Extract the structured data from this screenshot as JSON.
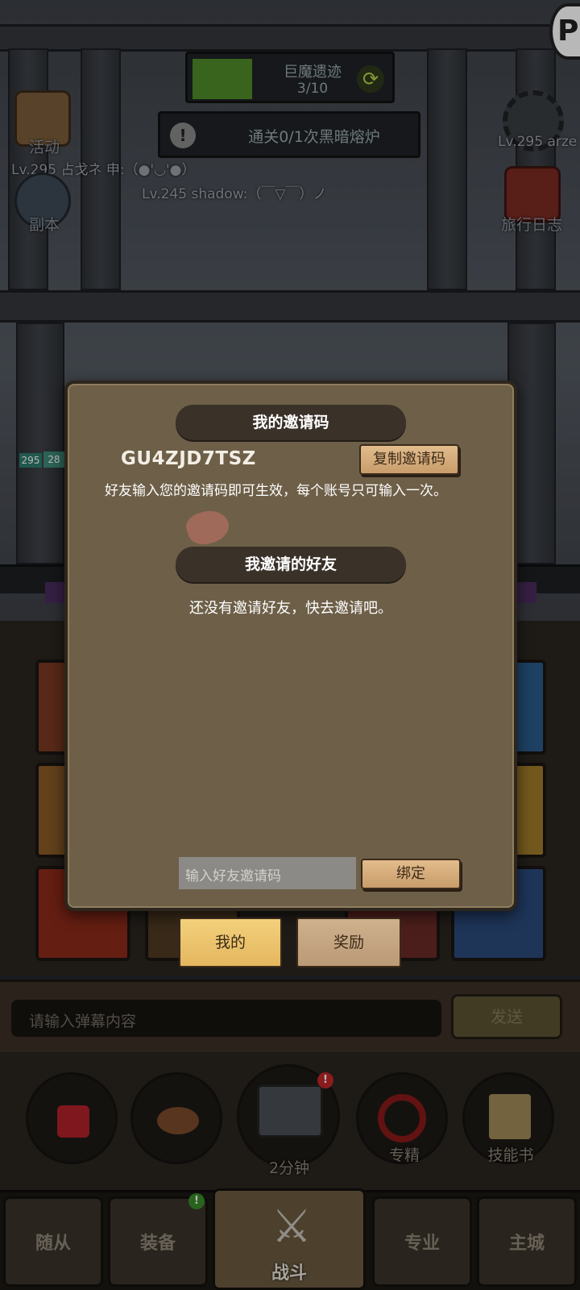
{
  "hud": {
    "dungeon_name": "巨魔遗迹",
    "dungeon_progress": "3/10",
    "quest_text": "通关0/1次黑暗熔炉",
    "activity_label": "活动",
    "dungeon_label": "副本",
    "travel_log_label": "旅行日志",
    "player1": "Lv.295 占戈ネ 申:（●'◡'●）",
    "player2": "Lv.245 shadow:（￣▽￣）ノ",
    "player3": "Lv.295 arze",
    "hp_badge": "295",
    "hp_badge2": "28"
  },
  "modal": {
    "my_code_title": "我的邀请码",
    "invite_code": "GU4ZJD7TSZ",
    "copy_button": "复制邀请码",
    "description": "好友输入您的邀请码即可生效，每个账号只可输入一次。",
    "friends_title": "我邀请的好友",
    "no_friends_text": "还没有邀请好友，快去邀请吧。",
    "input_placeholder": "输入好友邀请码",
    "bind_button": "绑定",
    "tab_mine": "我的",
    "tab_reward": "奖励"
  },
  "chat": {
    "placeholder": "请输入弹幕内容",
    "send_button": "发送"
  },
  "actions": {
    "chest_timer": "2分钟",
    "mastery": "专精",
    "skill_book": "技能书",
    "chest_badge": "!"
  },
  "nav": {
    "followers": "随从",
    "equipment": "装备",
    "battle": "战斗",
    "profession": "专业",
    "main_city": "主城",
    "equipment_badge": "!"
  },
  "colors": {
    "modal_bg": "#6e5f48",
    "ribbon": "#3a3129",
    "tab_active": "#f3d07c",
    "progress_green": "#4f8b2a"
  }
}
